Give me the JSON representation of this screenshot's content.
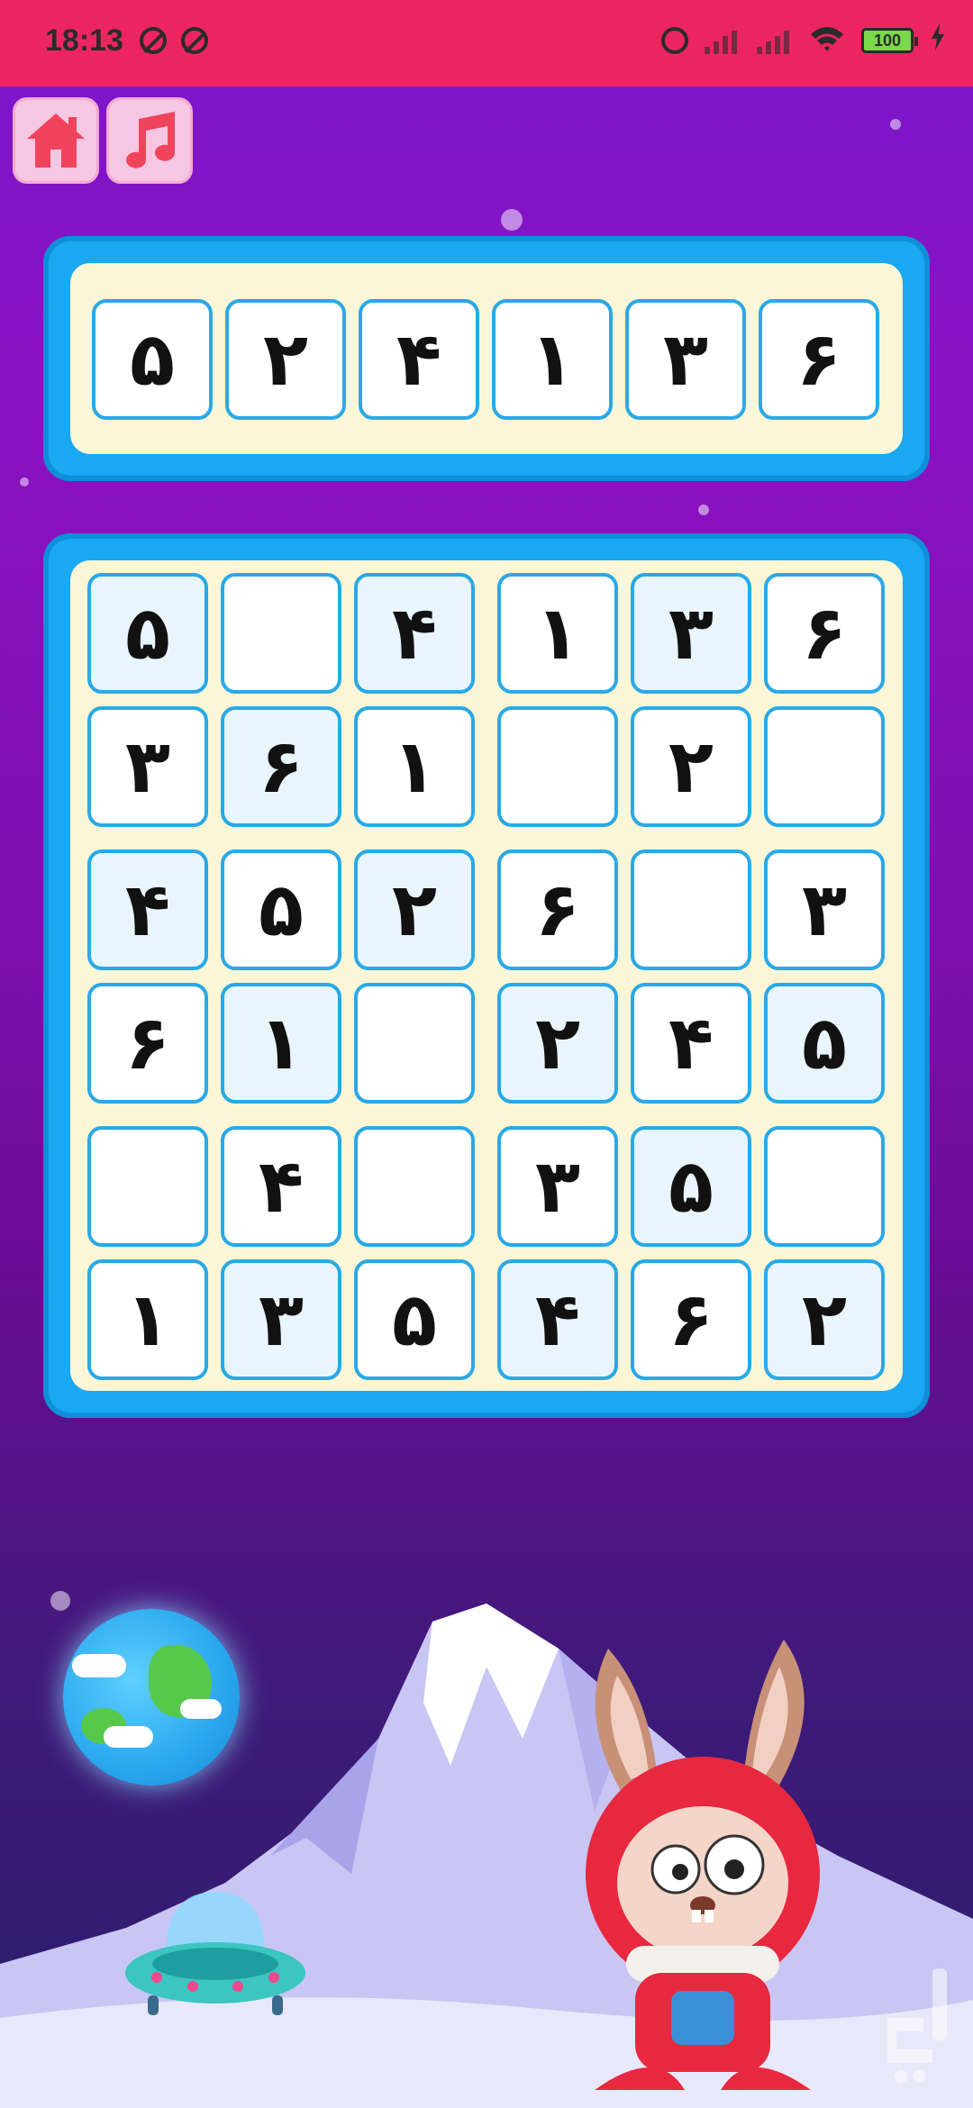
{
  "status_bar": {
    "time": "18:13",
    "battery": "100",
    "icons": [
      "do-not-disturb-icon",
      "do-not-disturb-icon",
      "alarm-icon",
      "signal-icon",
      "signal-icon",
      "wifi-icon",
      "battery-icon",
      "charging-bolt-icon"
    ]
  },
  "toolbar": {
    "home_icon": "home-icon",
    "music_icon": "music-note-icon"
  },
  "answer_row": [
    "۵",
    "۲",
    "۴",
    "۱",
    "۳",
    "۶"
  ],
  "board": [
    [
      "۵",
      "",
      "۴",
      "۱",
      "۳",
      "۶"
    ],
    [
      "۳",
      "۶",
      "۱",
      "",
      "۲",
      ""
    ],
    [
      "۴",
      "۵",
      "۲",
      "۶",
      "",
      "۳"
    ],
    [
      "۶",
      "۱",
      "",
      "۲",
      "۴",
      "۵"
    ],
    [
      "",
      "۴",
      "",
      "۳",
      "۵",
      ""
    ],
    [
      "۱",
      "۳",
      "۵",
      "۴",
      "۶",
      "۲"
    ]
  ],
  "colors": {
    "status_bar": "#ec2560",
    "panel_frame": "#1aa8f2",
    "panel_fill": "#fbf6d5",
    "cell_border": "#29a9e6",
    "button_bg": "#f6c7e3",
    "icon_color": "#f0445c"
  }
}
